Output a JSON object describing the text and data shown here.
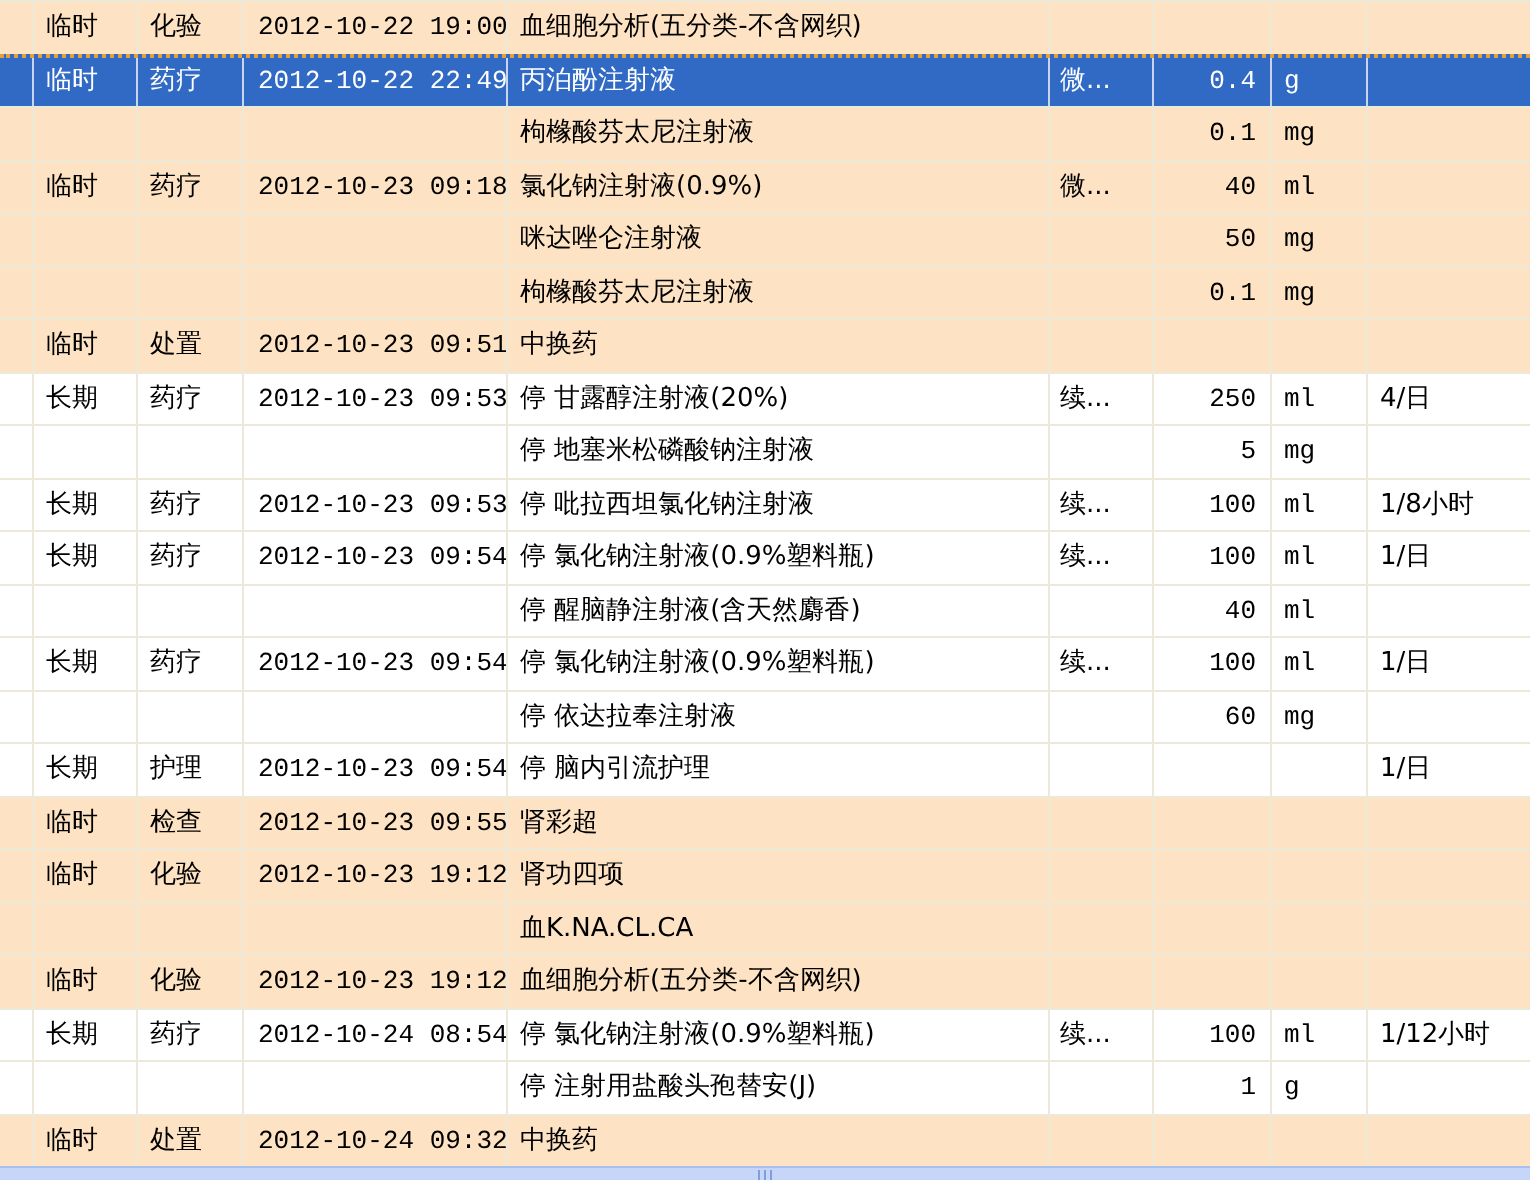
{
  "rows": [
    {
      "kind": "temporary",
      "selected": false,
      "term": "临时",
      "category": "化验",
      "time": "2012-10-22 19:00",
      "content": "血细胞分析(五分类-不含网织)"
    },
    {
      "kind": "temporary",
      "selected": true,
      "term": "临时",
      "category": "药疗",
      "time": "2012-10-22 22:49",
      "content": "丙泊酚注射液",
      "method": "微...",
      "dose": "0.4",
      "unit": "g"
    },
    {
      "kind": "temporary",
      "selected": false,
      "content": "枸橼酸芬太尼注射液",
      "dose": "0.1",
      "unit": "mg"
    },
    {
      "kind": "temporary",
      "selected": false,
      "term": "临时",
      "category": "药疗",
      "time": "2012-10-23 09:18",
      "content": "氯化钠注射液(0.9%)",
      "method": "微...",
      "dose": "40",
      "unit": "ml"
    },
    {
      "kind": "temporary",
      "selected": false,
      "content": "咪达唑仑注射液",
      "dose": "50",
      "unit": "mg"
    },
    {
      "kind": "temporary",
      "selected": false,
      "content": "枸橼酸芬太尼注射液",
      "dose": "0.1",
      "unit": "mg"
    },
    {
      "kind": "temporary",
      "selected": false,
      "term": "临时",
      "category": "处置",
      "time": "2012-10-23 09:51",
      "content": "中换药"
    },
    {
      "kind": "long_term",
      "selected": false,
      "term": "长期",
      "category": "药疗",
      "time": "2012-10-23 09:53",
      "content": "停 甘露醇注射液(20%)",
      "method": "续...",
      "dose": "250",
      "unit": "ml",
      "frequency": "4/日"
    },
    {
      "kind": "long_term",
      "selected": false,
      "content": "停 地塞米松磷酸钠注射液",
      "dose": "5",
      "unit": "mg"
    },
    {
      "kind": "long_term",
      "selected": false,
      "term": "长期",
      "category": "药疗",
      "time": "2012-10-23 09:53",
      "content": "停 吡拉西坦氯化钠注射液",
      "method": "续...",
      "dose": "100",
      "unit": "ml",
      "frequency": "1/8小时"
    },
    {
      "kind": "long_term",
      "selected": false,
      "term": "长期",
      "category": "药疗",
      "time": "2012-10-23 09:54",
      "content": "停 氯化钠注射液(0.9%塑料瓶)",
      "method": "续...",
      "dose": "100",
      "unit": "ml",
      "frequency": "1/日"
    },
    {
      "kind": "long_term",
      "selected": false,
      "content": "停 醒脑静注射液(含天然麝香)",
      "dose": "40",
      "unit": "ml"
    },
    {
      "kind": "long_term",
      "selected": false,
      "term": "长期",
      "category": "药疗",
      "time": "2012-10-23 09:54",
      "content": "停 氯化钠注射液(0.9%塑料瓶)",
      "method": "续...",
      "dose": "100",
      "unit": "ml",
      "frequency": "1/日"
    },
    {
      "kind": "long_term",
      "selected": false,
      "content": "停 依达拉奉注射液",
      "dose": "60",
      "unit": "mg"
    },
    {
      "kind": "long_term",
      "selected": false,
      "term": "长期",
      "category": "护理",
      "time": "2012-10-23 09:54",
      "content": "停 脑内引流护理",
      "frequency": "1/日"
    },
    {
      "kind": "temporary",
      "selected": false,
      "term": "临时",
      "category": "检查",
      "time": "2012-10-23 09:55",
      "content": "肾彩超"
    },
    {
      "kind": "temporary",
      "selected": false,
      "term": "临时",
      "category": "化验",
      "time": "2012-10-23 19:12",
      "content": "肾功四项"
    },
    {
      "kind": "temporary",
      "selected": false,
      "content": "血K.NA.CL.CA"
    },
    {
      "kind": "temporary",
      "selected": false,
      "term": "临时",
      "category": "化验",
      "time": "2012-10-23 19:12",
      "content": "血细胞分析(五分类-不含网织)"
    },
    {
      "kind": "long_term",
      "selected": false,
      "term": "长期",
      "category": "药疗",
      "time": "2012-10-24 08:54",
      "content": "停 氯化钠注射液(0.9%塑料瓶)",
      "method": "续...",
      "dose": "100",
      "unit": "ml",
      "frequency": "1/12小时"
    },
    {
      "kind": "long_term",
      "selected": false,
      "content": "停 注射用盐酸头孢替安(J)",
      "dose": "1",
      "unit": "g"
    },
    {
      "kind": "temporary",
      "selected": false,
      "term": "临时",
      "category": "处置",
      "time": "2012-10-24 09:32",
      "content": "中换药"
    }
  ]
}
